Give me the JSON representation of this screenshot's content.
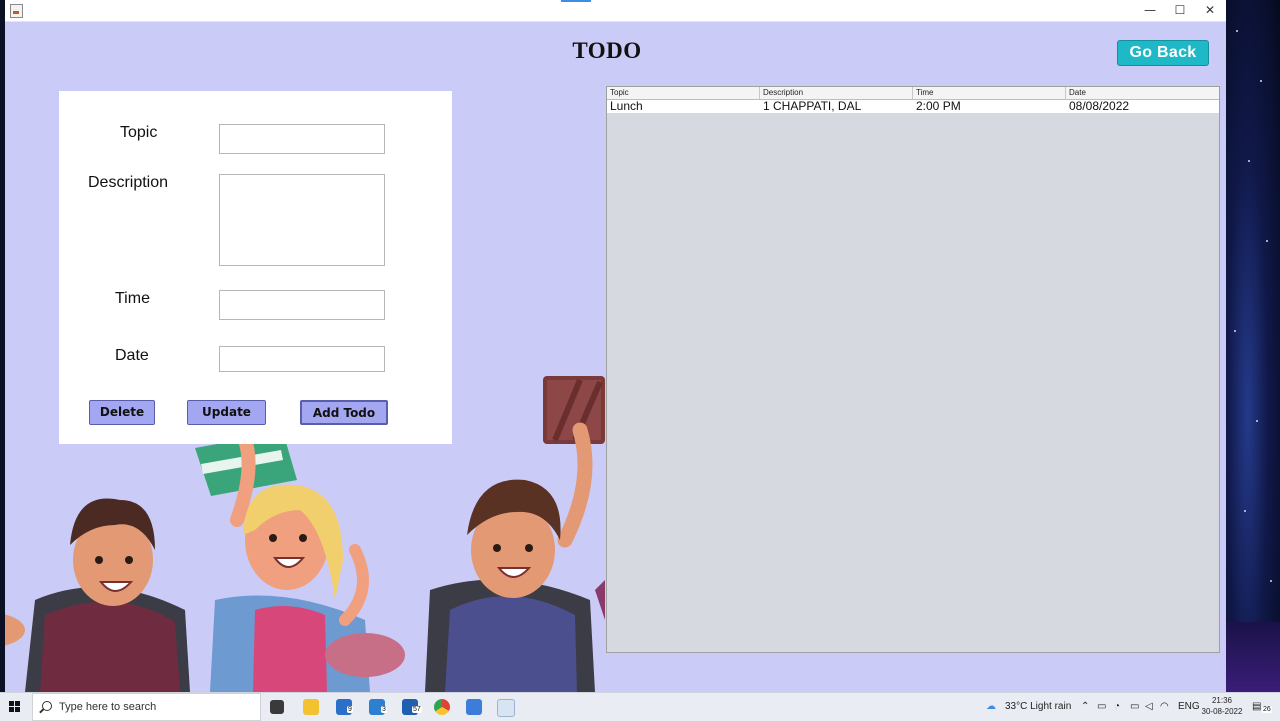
{
  "window": {
    "controls": {
      "minimize": "—",
      "maximize": "☐",
      "close": "✕"
    }
  },
  "header": {
    "title": "TODO",
    "go_back_label": "Go Back",
    "go_back_color": "#1fb8c6"
  },
  "form": {
    "topic_label": "Topic",
    "topic_value": "",
    "description_label": "Description",
    "description_value": "",
    "time_label": "Time",
    "time_value": "",
    "date_label": "Date",
    "date_value": "",
    "delete_label": "Delete",
    "update_label": "Update",
    "add_label": "Add Todo",
    "button_color": "#a3a6f0"
  },
  "table": {
    "columns": [
      "Topic",
      "Description",
      "Time",
      "Date"
    ],
    "rows": [
      [
        "Lunch",
        "1 CHAPPATI, DAL",
        "2:00 PM",
        "08/08/2022"
      ]
    ]
  },
  "colors": {
    "window_bg": "#cbcbf8",
    "table_bg": "#d7d9e1"
  },
  "taskbar": {
    "search_placeholder": "Type here to search",
    "badges": [
      "9",
      "3",
      "57"
    ],
    "weather": "33°C  Light rain",
    "language": "ENG",
    "time": "21:36",
    "date": "30-08-2022",
    "notification_count": "26"
  }
}
